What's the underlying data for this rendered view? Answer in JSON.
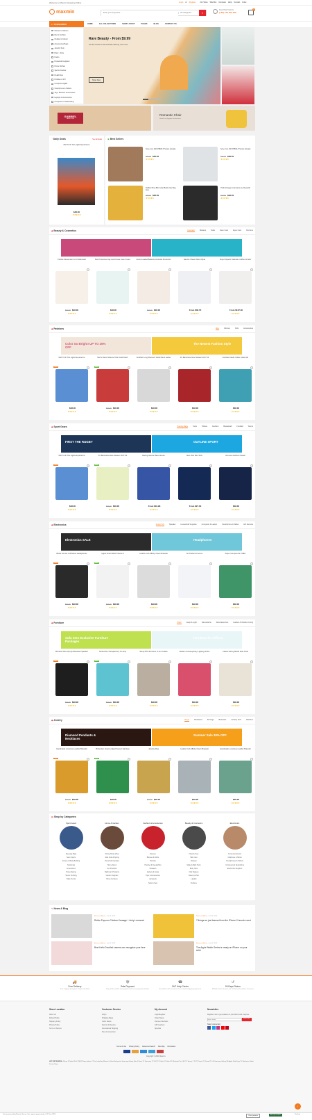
{
  "topbar": {
    "welcome": "Welcome to Maxmin shopping Online",
    "login": "Login",
    "or": "or",
    "register": "Register",
    "links": [
      "Our Store",
      "Wish list",
      "Compare",
      "Help",
      "Contact",
      "Links"
    ]
  },
  "header": {
    "logo": "maxmin",
    "search_placeholder": "Enter your Keywords ...",
    "category": "All Categories",
    "phone_label": "Need Help? Call Us",
    "phone": "(+84) 123 456 789",
    "cart_count": "0"
  },
  "nav": {
    "categories": "CATEGORIES",
    "items": [
      "HOME",
      "ALL COLLECTIONS",
      "SHOP LAYOUT",
      "PAGES",
      "BLOG",
      "CONTACT US"
    ]
  },
  "sidebar": [
    "Women's Fashion",
    "Men's Fashion",
    "Outdoor & Indoor",
    "Accessories Bags",
    "Jewelry Sets",
    "Party - Style",
    "Foods",
    "Household supplies",
    "Home Kitchen",
    "Sports Outdoor",
    "Health Diet",
    "Hobbies & DIY",
    "Computer Digital",
    "Smartphone & Tablets",
    "Toys, Books & Accessories",
    "Laptops & Accessories",
    "Computers & Networking"
  ],
  "hero": {
    "title": "Rare Beauty - From $9.99",
    "subtitle": "Get the hottest in demand fall makeup, and more.",
    "button": "Shop Now"
  },
  "promo": [
    {
      "title": "GABRIEL",
      "sub": "NEW YORK"
    },
    {
      "title": "Romantic Chair",
      "sub": "Stretch our bygone for business"
    }
  ],
  "daily": {
    "title": "Daily Deals",
    "view": "See all deals",
    "name": "Mid Tl Inh The Lights Experience",
    "price": "$48.00"
  },
  "best": {
    "title": "Best Sellers",
    "items": [
      {
        "name": "Sony, Inec 40th PRMO-P Series Lifestyle",
        "old": "$60.00",
        "price": "$48.00"
      },
      {
        "name": "Sony, Inec 40th PRMO-P Series Lifestyle",
        "old": "$68.00",
        "price": "$48.00"
      },
      {
        "name": "Stafford Prep Bob Cedar Bottle New Bag Sets",
        "old": "$60.00",
        "price": "$48.00"
      },
      {
        "name": "Thails Fiorgay Cosmeticus-are Ryouwith",
        "old": "$60.00",
        "price": "$48.00"
      }
    ]
  },
  "sections": [
    {
      "title": "Beauty & Cosmetics",
      "tabs": [
        "Cosmetic",
        "Makeup",
        "Nails",
        "Face Care",
        "Eyes Care",
        "Perfume"
      ],
      "banners": [
        "",
        ""
      ],
      "products": [
        {
          "name": "Cubicle Moisturiser For Problematic",
          "old": "$60.00",
          "price": "$48.00"
        },
        {
          "name": "Skin Protection Day Avoid Case Care Cream",
          "old": "",
          "price": "$48.00"
        },
        {
          "name": "Oolert Loaded Balancie Almarzal Protection",
          "old": "$60.00",
          "price": "$48.00"
        },
        {
          "name": "Electric Shaver Micro Pipal",
          "old": "",
          "price": "From $48.73"
        },
        {
          "name": "Super Dipacto Stainless Coffee Grinder",
          "old": "",
          "price": "From $167.00"
        }
      ]
    },
    {
      "title": "Fashions",
      "tabs": [
        "Men",
        "Women",
        "Kids",
        "Accessories"
      ],
      "banners": [
        "Color So Bright! UP TO 25% OFF",
        "The Newest Fashion Style"
      ],
      "products": [
        {
          "name": "Mid Tl Inh The Lights Experience",
          "old": "",
          "price": "$48.00"
        },
        {
          "name": "Men's Retro Sleeves Tshirt Gold Stitch",
          "old": "$60.00",
          "price": "$48.00"
        },
        {
          "name": "Southlet Long Sleeved / Fade Mens Jacket",
          "old": "",
          "price": "$48.00"
        },
        {
          "name": "FC Barcelona New Season 2017 Kit",
          "old": "",
          "price": "$48.00"
        },
        {
          "name": "Excellent lasdir Golde Label Hat",
          "old": "",
          "price": "$48.00"
        }
      ]
    },
    {
      "title": "Sport Gears",
      "tabs": [
        "Training Bags",
        "Tools",
        "Pillows",
        "Fashion",
        "Basketball",
        "Football",
        "Tennis"
      ],
      "banners": [
        "FIRST THE RUGBY",
        "OUTLINE SPORT"
      ],
      "products": [
        {
          "name": "Mid Tl Inh The Lights Experience",
          "old": "",
          "price": "$48.00"
        },
        {
          "name": "FC Barcelona New Season 2017 Kit",
          "old": "$60.00",
          "price": "$48.00"
        },
        {
          "name": "Racing Gloves Race Gloves",
          "old": "",
          "price": "From $19.98"
        },
        {
          "name": "Men Polo Slim Shirt",
          "old": "",
          "price": "From $27.00"
        },
        {
          "name": "Summer Fashion Classic",
          "old": "",
          "price": "$48.00"
        }
      ]
    },
    {
      "title": "Electronics",
      "tabs": [
        "Smart TVs",
        "Speaker",
        "Household Supplies",
        "Computer & Laptop",
        "Smartphone & Tablet",
        "HD Devices"
      ],
      "banners": [
        "Electronics SALE",
        "Headphones"
      ],
      "products": [
        {
          "name": "Beats Go Get 1 Wireless Headphones",
          "old": "$60.00",
          "price": "$48.00"
        },
        {
          "name": "Apple Smart Watch Series 4",
          "old": "$60.00",
          "price": "$48.00"
        },
        {
          "name": "Leather Cob Affinity Clown Bracelet",
          "old": "",
          "price": "$48.00"
        },
        {
          "name": "Air Purifier Air Home",
          "old": "",
          "price": "$48.00"
        },
        {
          "name": "Super Compact Air Chiller",
          "old": "",
          "price": "$48.00"
        }
      ]
    },
    {
      "title": "Furniture",
      "tabs": [
        "Chair",
        "Lamp & Light",
        "Decorations",
        "Decorative Arts",
        "Garden & Outdoor Living"
      ],
      "banners": [
        "Sofa Sets Exclusive Furniture Packages",
        "Furniture for Offices"
      ],
      "products": [
        {
          "name": "Brendon Mini Pop-Up Bluetooth Speaker",
          "old": "$60.00",
          "price": "$48.00"
        },
        {
          "name": "Sortie Plus Transparency Tl Lamp",
          "old": "$60.00",
          "price": "$48.00"
        },
        {
          "name": "Savoy RTA Premium Tl Arm Coffee",
          "old": "",
          "price": "$48.00"
        },
        {
          "name": "Modern Contemporary Lighting W/ E1",
          "old": "",
          "price": "$48.00"
        },
        {
          "name": "Classic Dining Board Side Chair",
          "old": "",
          "price": "$48.00"
        }
      ]
    },
    {
      "title": "Jewelry",
      "tabs": [
        "Rings",
        "Necklaces",
        "Earrings",
        "Bracelets",
        "Jewelry Sets",
        "Watches"
      ],
      "banners": [
        "Diamond Pendants & Necklaces",
        "Summer Sale 30% OFF"
      ],
      "products": [
        {
          "name": "Handmade Luxurious Leather Bracelet",
          "old": "$60.00",
          "price": "$48.00"
        },
        {
          "name": "Bohemian Jewel Lodged Season Earrings",
          "old": "",
          "price": "$48.00"
        },
        {
          "name": "Jewelry Ring",
          "old": "$60.00",
          "price": "$48.00"
        },
        {
          "name": "Leather Cob Affinity Clown Bracelet",
          "old": "",
          "price": "$48.00"
        },
        {
          "name": "Handmade Luxurious Leather Bracelet",
          "old": "",
          "price": "$48.00"
        }
      ]
    }
  ],
  "shopcat": {
    "title": "Shop by Categories",
    "cats": [
      {
        "name": "Sport Gears",
        "items": [
          "Sleeping Bags",
          "Team Sports",
          "Fitness & Body Building",
          "Swimming",
          "Accessories",
          "Horse Racing",
          "Sports Clothing",
          "Table Tennis"
        ]
      },
      {
        "name": "Home & Garden",
        "items": [
          "Dining Table & Bar",
          "Sofa Sofa & Spring",
          "Household supplies",
          "Home Decor",
          "Pet Products",
          "Bathroom Products",
          "Garden Supplies",
          "Home Furniture"
        ]
      },
      {
        "name": "Fashion & Accessories",
        "items": [
          "Dresses",
          "Blouses & Shirts",
          "Hoodies",
          "Hoodies & Sweatshirts",
          "Sweaters",
          "Jackets & Coats",
          "Tops & Accessories",
          "Jumpsuits",
          "Suits & Sets"
        ]
      },
      {
        "name": "Beauty & Cosmetics",
        "items": [
          "Hand & Toes",
          "Skin Care",
          "Makeup",
          "Make & Bath Tools",
          "Body Care",
          "Oral Hygiene",
          "Beauty & Hair",
          "Lipstick",
          "Perfume"
        ]
      },
      {
        "name": "Electronics",
        "items": [
          "Consumer Electro",
          "Cellphone & Tablet",
          "Smartphones & Tablets",
          "Computers & Networking",
          "Electronics Supplies"
        ]
      }
    ]
  },
  "blog": {
    "title": "News & Blog",
    "posts": [
      {
        "author": "Business Admin",
        "date": "Jun 05, 2023",
        "title": "Richie Popcorn Chicken Karaage + Achy Lemonad"
      },
      {
        "author": "Business Admin",
        "date": "Jun 05, 2023",
        "title": "7 things we just learned from the iPhone X launch event"
      },
      {
        "author": "Business Admin",
        "date": "Jun 05, 2023",
        "title": "Best Hello Doodled camera can recognize your face"
      },
      {
        "author": "Business Admin",
        "date": "Jun 05, 2023",
        "title": "The Apple Watch Series is nearly an iPhone on your wrist"
      }
    ]
  },
  "services": [
    {
      "title": "Free Delivery",
      "sub": "Free shipping throughout Europe and North"
    },
    {
      "title": "Safe Payment",
      "sub": "Pay with the world's most popular and secure payment methods"
    },
    {
      "title": "24/7 Help Center",
      "sub": "Round-the-clock assistance for a smooth shopping experience"
    },
    {
      "title": "90 Days Return",
      "sub": "Reliable returns if you're not satisfied with products & services"
    }
  ],
  "footer": {
    "cols": [
      {
        "title": "Store Location",
        "items": [
          "About Us",
          "Refund Policy",
          "Shipping Policy",
          "Privacy Policy",
          "Terms of Service"
        ]
      },
      {
        "title": "Customer Service",
        "items": [
          "FAQ's",
          "Shipping Rates",
          "Order Status",
          "Returns & Returns",
          "International Shipping",
          "Size & Conversion"
        ]
      },
      {
        "title": "My Account",
        "items": [
          "Login/Register",
          "Order Status",
          "Payment Methods",
          "Gift Vouchers",
          "Specials"
        ]
      },
      {
        "title": "Newsletter",
        "items": [
          "Register now to get updates on promotions and coupons."
        ]
      }
    ],
    "email_placeholder": "Enter email",
    "subscribe": "Subscribe",
    "follow": "Stay Connected",
    "bottom_links": [
      "Terms of Use",
      "Privacy Policy",
      "Advanced Search",
      "Site Map",
      "Information"
    ],
    "copyright": "Copyright © 2021 Maxmin.",
    "hot_keywords_label": "HOT KEYWORDS:",
    "hot_keywords": "iPhone 8   Triple 4Pad 3   MP4 Player   Iphone 7 Plus   Lady Bag   Women's Short   Backpacks   Samsung Galaxy Note 8   Sony TV   Samsung TV   LED TV   Tablet 7 Polerhl 32   Macbook Pro   LED TV   Iphone 7   20 TV   Smart TV   Sound TV 4k   Samsung Galaxy S8   Apple iPad   Sony TV   Bathroom Tablet Screen   Bags"
  },
  "cookie": {
    "text": "You're protected by Maxmin Secure   Your request guaranteed at 3 27 Jan 2023",
    "decline": "Close popover",
    "accept": "Accept cookies",
    "pref": "Pref box"
  }
}
